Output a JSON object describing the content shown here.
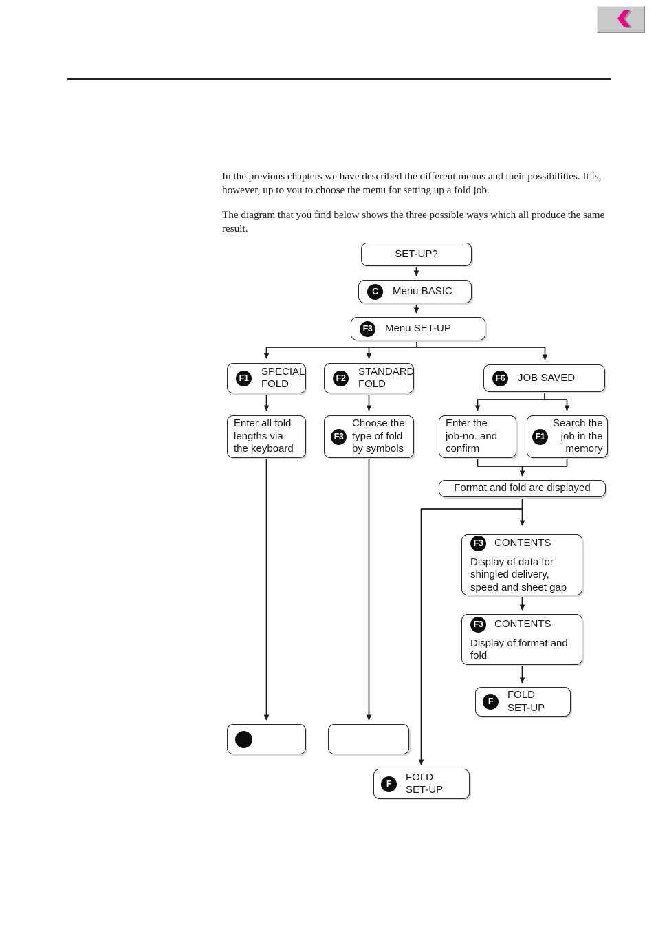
{
  "header": {
    "nav_button": {
      "icon": "chevron-left-icon",
      "accent_color": "#ec008c",
      "face_color": "#c9c9c9"
    }
  },
  "content": {
    "paragraph_1": "In the previous chapters we have described the different menus and their possibilities. It is, however, up to you to choose the menu for setting up a fold job.",
    "paragraph_2": "The diagram that you find below shows the three possible ways which all produce the same result."
  },
  "flowchart": {
    "nodes": {
      "setup_question": {
        "text": "SET-UP?"
      },
      "menu_basic": {
        "key": "C",
        "text": "Menu BASIC"
      },
      "menu_setup": {
        "key": "F3",
        "text": "Menu SET-UP"
      },
      "special_fold": {
        "key": "F1",
        "text": "SPECIAL\nFOLD"
      },
      "standard_fold": {
        "key": "F2",
        "text": "STANDARD\nFOLD"
      },
      "job_saved": {
        "key": "F6",
        "text": "JOB SAVED"
      },
      "enter_lengths": {
        "text": "Enter all fold\nlengths via\nthe keyboard"
      },
      "choose_type": {
        "key": "F3",
        "text": "Choose the\ntype of fold\nby symbols"
      },
      "enter_jobno": {
        "text": "Enter the\njob-no. and\nconfirm"
      },
      "search_job": {
        "key": "F1",
        "text": "Search the\njob in the\nmemory"
      },
      "format_displayed": {
        "text": "Format and fold are displayed"
      },
      "contents_1": {
        "key": "F3",
        "title": "CONTENTS",
        "desc": "Display of data for\nshingled delivery,\nspeed and sheet gap"
      },
      "contents_2": {
        "key": "F3",
        "title": "CONTENTS",
        "desc": "Display of format and\nfold"
      },
      "fold_setup_right": {
        "key": "F",
        "text": "FOLD\nSET-UP"
      },
      "end_left": {
        "key": "",
        "text": ""
      },
      "end_mid": {
        "text": ""
      },
      "fold_setup_bottom": {
        "key": "F",
        "text": "FOLD\nSET-UP"
      }
    }
  }
}
